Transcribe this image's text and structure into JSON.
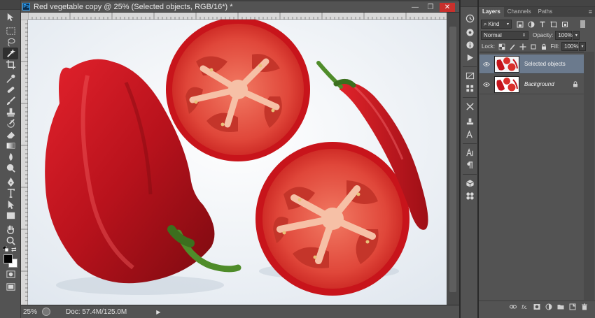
{
  "document": {
    "app_badge": "Ps",
    "title": "Red vegetable copy @ 25% (Selected objects, RGB/16*) *",
    "window_buttons": {
      "minimize": "—",
      "restore": "❐",
      "close": "✕"
    }
  },
  "status_bar": {
    "zoom": "25%",
    "doc_info": "Doc: 57.4M/125.0M",
    "menu_arrow": "▶"
  },
  "tools": [
    {
      "id": "move",
      "icon": "move-icon"
    },
    {
      "id": "marquee",
      "icon": "marquee-icon"
    },
    {
      "id": "lasso",
      "icon": "lasso-icon"
    },
    {
      "id": "magic-wand",
      "icon": "magic-wand-icon",
      "active": true
    },
    {
      "id": "crop",
      "icon": "crop-icon"
    },
    {
      "id": "eyedropper",
      "icon": "eyedropper-icon"
    },
    {
      "id": "healing",
      "icon": "healing-brush-icon"
    },
    {
      "id": "brush",
      "icon": "brush-icon"
    },
    {
      "id": "stamp",
      "icon": "clone-stamp-icon"
    },
    {
      "id": "history-brush",
      "icon": "history-brush-icon"
    },
    {
      "id": "eraser",
      "icon": "eraser-icon"
    },
    {
      "id": "gradient",
      "icon": "gradient-icon"
    },
    {
      "id": "blur",
      "icon": "blur-icon"
    },
    {
      "id": "dodge",
      "icon": "dodge-icon"
    },
    {
      "id": "pen",
      "icon": "pen-icon"
    },
    {
      "id": "type",
      "icon": "type-icon"
    },
    {
      "id": "path-select",
      "icon": "path-selection-icon"
    },
    {
      "id": "shape",
      "icon": "shape-icon"
    },
    {
      "id": "hand",
      "icon": "hand-icon"
    },
    {
      "id": "zoom",
      "icon": "zoom-icon"
    }
  ],
  "colors": {
    "foreground": "#000000",
    "background": "#ffffff",
    "selected_layer": "#6b7a8d",
    "close_button": "#c9302c"
  },
  "layers_panel": {
    "tabs": [
      {
        "label": "Layers",
        "active": true
      },
      {
        "label": "Channels",
        "active": false
      },
      {
        "label": "Paths",
        "active": false
      }
    ],
    "menu_icon": "≡",
    "filter": {
      "kind_label": "Kind"
    },
    "blend_mode": "Normal",
    "opacity_label": "Opacity:",
    "opacity_value": "100%",
    "lock_label": "Lock:",
    "fill_label": "Fill:",
    "fill_value": "100%",
    "layers": [
      {
        "name": "Selected objects",
        "selected": true,
        "visible": true,
        "locked": false,
        "italic": false
      },
      {
        "name": "Background",
        "selected": false,
        "visible": true,
        "locked": true,
        "italic": true
      }
    ],
    "footer_icons": [
      "link-icon",
      "fx-icon",
      "mask-icon",
      "adjustment-icon",
      "group-icon",
      "new-layer-icon",
      "trash-icon"
    ],
    "footer_fx": "fx."
  },
  "dock_icons": [
    "history-icon",
    "properties-icon",
    "info-icon",
    "actions-icon",
    "adjustments-icon",
    "brush-presets-icon",
    "clone-source-icon",
    "character-styles-icon",
    "paragraph-styles-icon",
    "character-icon",
    "paragraph-icon",
    "3d-icon",
    "notes-icon"
  ]
}
